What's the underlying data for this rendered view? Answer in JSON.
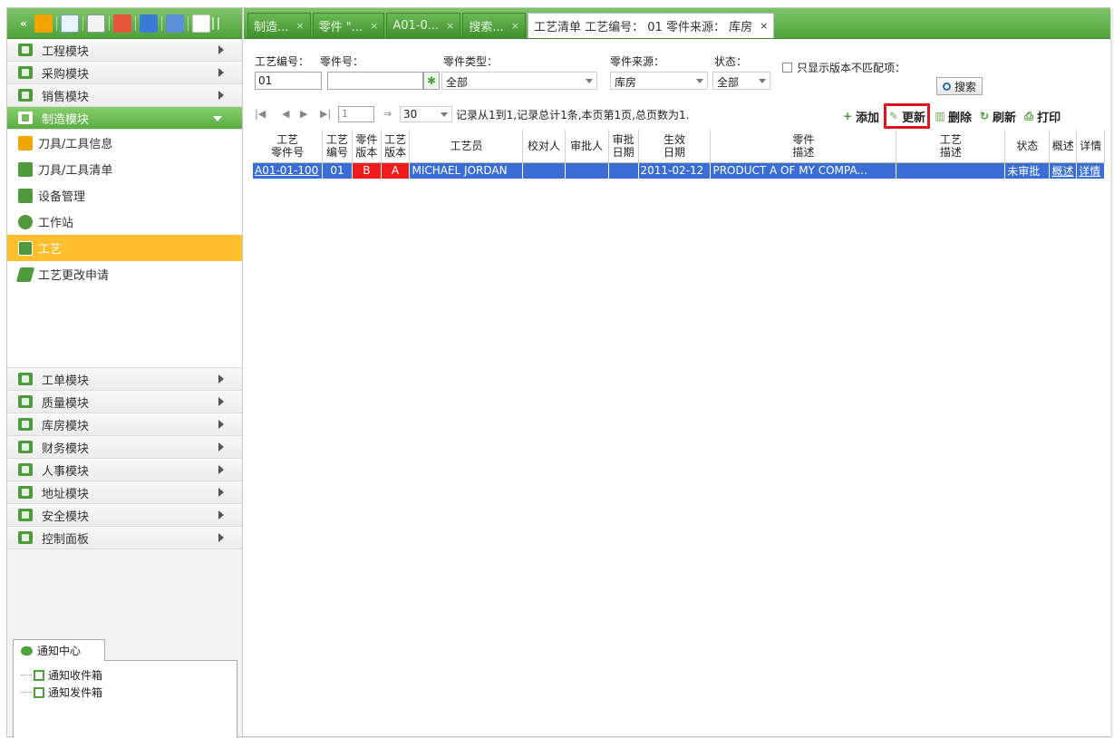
{
  "toolbar_icons": [
    "collapse-icon",
    "users-icon",
    "mail-icon",
    "document-icon",
    "chart-icon",
    "window-icon",
    "network-icon",
    "home-icon",
    "grip-icon"
  ],
  "toolbar": {
    "collapse_glyph": "«"
  },
  "sidebar": {
    "modules_top": [
      {
        "label": "工程模块",
        "icon": "module-icon"
      },
      {
        "label": "采购模块",
        "icon": "module-icon"
      },
      {
        "label": "销售模块",
        "icon": "module-icon"
      }
    ],
    "active_module": {
      "label": "制造模块",
      "icon": "module-icon"
    },
    "sub_items": [
      {
        "label": "刀具/工具信息",
        "icon": "wrench-icon",
        "color": "#f0a500"
      },
      {
        "label": "刀具/工具清单",
        "icon": "list-icon",
        "color": "#4e9a3c"
      },
      {
        "label": "设备管理",
        "icon": "equipment-icon",
        "color": "#4e9a3c"
      },
      {
        "label": "工作站",
        "icon": "workstation-icon",
        "color": "#4e9a3c"
      },
      {
        "label": "工艺",
        "icon": "process-icon",
        "color": "#4e9a3c"
      },
      {
        "label": "工艺更改申请",
        "icon": "change-request-icon",
        "color": "#4e9a3c"
      }
    ],
    "selected_sub_index": 4,
    "modules_bottom": [
      {
        "label": "工单模块",
        "icon": "module-icon"
      },
      {
        "label": "质量模块",
        "icon": "module-icon"
      },
      {
        "label": "库房模块",
        "icon": "module-icon"
      },
      {
        "label": "财务模块",
        "icon": "module-icon"
      },
      {
        "label": "人事模块",
        "icon": "module-icon"
      },
      {
        "label": "地址模块",
        "icon": "module-icon"
      },
      {
        "label": "安全模块",
        "icon": "module-icon"
      },
      {
        "label": "控制面板",
        "icon": "module-icon"
      }
    ]
  },
  "notice": {
    "tab_label": "通知中心",
    "items": [
      "通知收件箱",
      "通知发件箱"
    ]
  },
  "tabs": [
    {
      "label": "制造...",
      "close": "×"
    },
    {
      "label": "零件 \"...",
      "close": "×"
    },
    {
      "label": "A01-0...",
      "close": "×"
    },
    {
      "label": "搜索...",
      "close": "×"
    },
    {
      "label": "工艺清单 工艺编号： 01 零件来源： 库房",
      "close": "×",
      "active": true
    }
  ],
  "filters": {
    "process_no_label": "工艺编号：",
    "process_no_value": "01",
    "part_no_label": "零件号：",
    "part_no_value": "",
    "part_type_label": "零件类型：",
    "part_type_value": "全部",
    "part_source_label": "零件来源：",
    "part_source_value": "库房",
    "status_label": "状态：",
    "status_value": "全部",
    "mismatch_label": "只显示版本不匹配项：",
    "search_label": "搜索"
  },
  "pager": {
    "first": "|◀",
    "prev": "◀",
    "next": "▶",
    "last": "▶|",
    "page": "1",
    "go": "⇒",
    "page_size": "30",
    "info": "记录从1到1,记录总计1条,本页第1页,总页数为1."
  },
  "actions": [
    {
      "label": "添加",
      "icon": "plus-icon",
      "glyph": "+",
      "color": "#3a9a2a"
    },
    {
      "label": "更新",
      "icon": "edit-icon",
      "glyph": "✎",
      "color": "#6aa84f",
      "highlight": true
    },
    {
      "label": "删除",
      "icon": "trash-icon",
      "glyph": "▥",
      "color": "#6aa84f"
    },
    {
      "label": "刷新",
      "icon": "refresh-icon",
      "glyph": "↻",
      "color": "#3a9a2a"
    },
    {
      "label": "打印",
      "icon": "print-icon",
      "glyph": "⎙",
      "color": "#3a9a2a"
    }
  ],
  "grid": {
    "headers": [
      [
        "工艺",
        "零件号"
      ],
      [
        "工艺",
        "编号"
      ],
      [
        "零件",
        "版本"
      ],
      [
        "工艺",
        "版本"
      ],
      [
        "工艺员",
        ""
      ],
      [
        "校对人",
        ""
      ],
      [
        "审批人",
        ""
      ],
      [
        "审批",
        "日期"
      ],
      [
        "生效",
        "日期"
      ],
      [
        "零件",
        "描述"
      ],
      [
        "工艺",
        "描述"
      ],
      [
        "状态",
        ""
      ],
      [
        "概述",
        ""
      ],
      [
        "详情",
        ""
      ]
    ],
    "rows": [
      [
        "A01-01-100",
        "01",
        "B",
        "A",
        "MICHAEL JORDAN",
        "",
        "",
        "",
        "2011-02-12",
        "PRODUCT A OF MY COMPA...",
        "",
        "未审批",
        "概述",
        "详情"
      ]
    ]
  }
}
